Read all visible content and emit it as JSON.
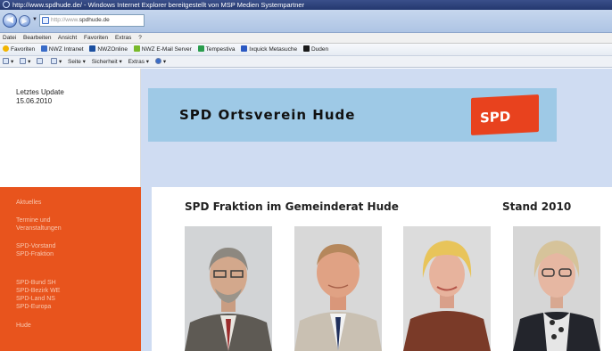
{
  "window": {
    "title": "http://www.spdhude.de/ - Windows Internet Explorer bereitgestellt von MSP Medien Systempartner"
  },
  "address": {
    "protocol": "http://www.",
    "url": "spdhude.de"
  },
  "menubar": [
    "Datei",
    "Bearbeiten",
    "Ansicht",
    "Favoriten",
    "Extras",
    "?"
  ],
  "favorites": [
    {
      "label": "Favoriten",
      "icon": "star-icon",
      "color": "#f2b400"
    },
    {
      "label": "NWZ Intranet",
      "icon": "ie-page-icon",
      "color": "#3a6cc8"
    },
    {
      "label": "NWZOnline",
      "icon": "nwz-icon",
      "color": "#1b4fa0"
    },
    {
      "label": "NWZ E-Mail Server",
      "icon": "nwz-mail-icon",
      "color": "#79b92b"
    },
    {
      "label": "Tempestiva",
      "icon": "tempestiva-icon",
      "color": "#2a9d4d"
    },
    {
      "label": "Ixquick Metasuche",
      "icon": "ixquick-icon",
      "color": "#2b59c3"
    },
    {
      "label": "Duden",
      "icon": "duden-icon",
      "color": "#1a1a1a"
    }
  ],
  "commandbar": [
    "Seite",
    "Sicherheit",
    "Extras"
  ],
  "page": {
    "update_label": "Letztes Update",
    "update_date": "15.06.2010",
    "banner_title": "SPD Ortsverein Hude",
    "logo_text": "SPD",
    "nav": [
      "Aktuelles",
      "Termine und",
      "Veranstaltungen",
      "SPD-Vorstand",
      "SPD-Fraktion",
      "SPD-Bund SH",
      "SPD-Bezirk WE",
      "SPD-Land NS",
      "SPD-Europa",
      "Hude"
    ],
    "heading": "SPD Fraktion im Gemeinderat Hude",
    "stand": "Stand 2010"
  },
  "colors": {
    "nav_orange": "#e8541d",
    "banner_blue": "#9ec9e6",
    "page_blue": "#cfdcf2",
    "logo_red": "#e8421e"
  }
}
